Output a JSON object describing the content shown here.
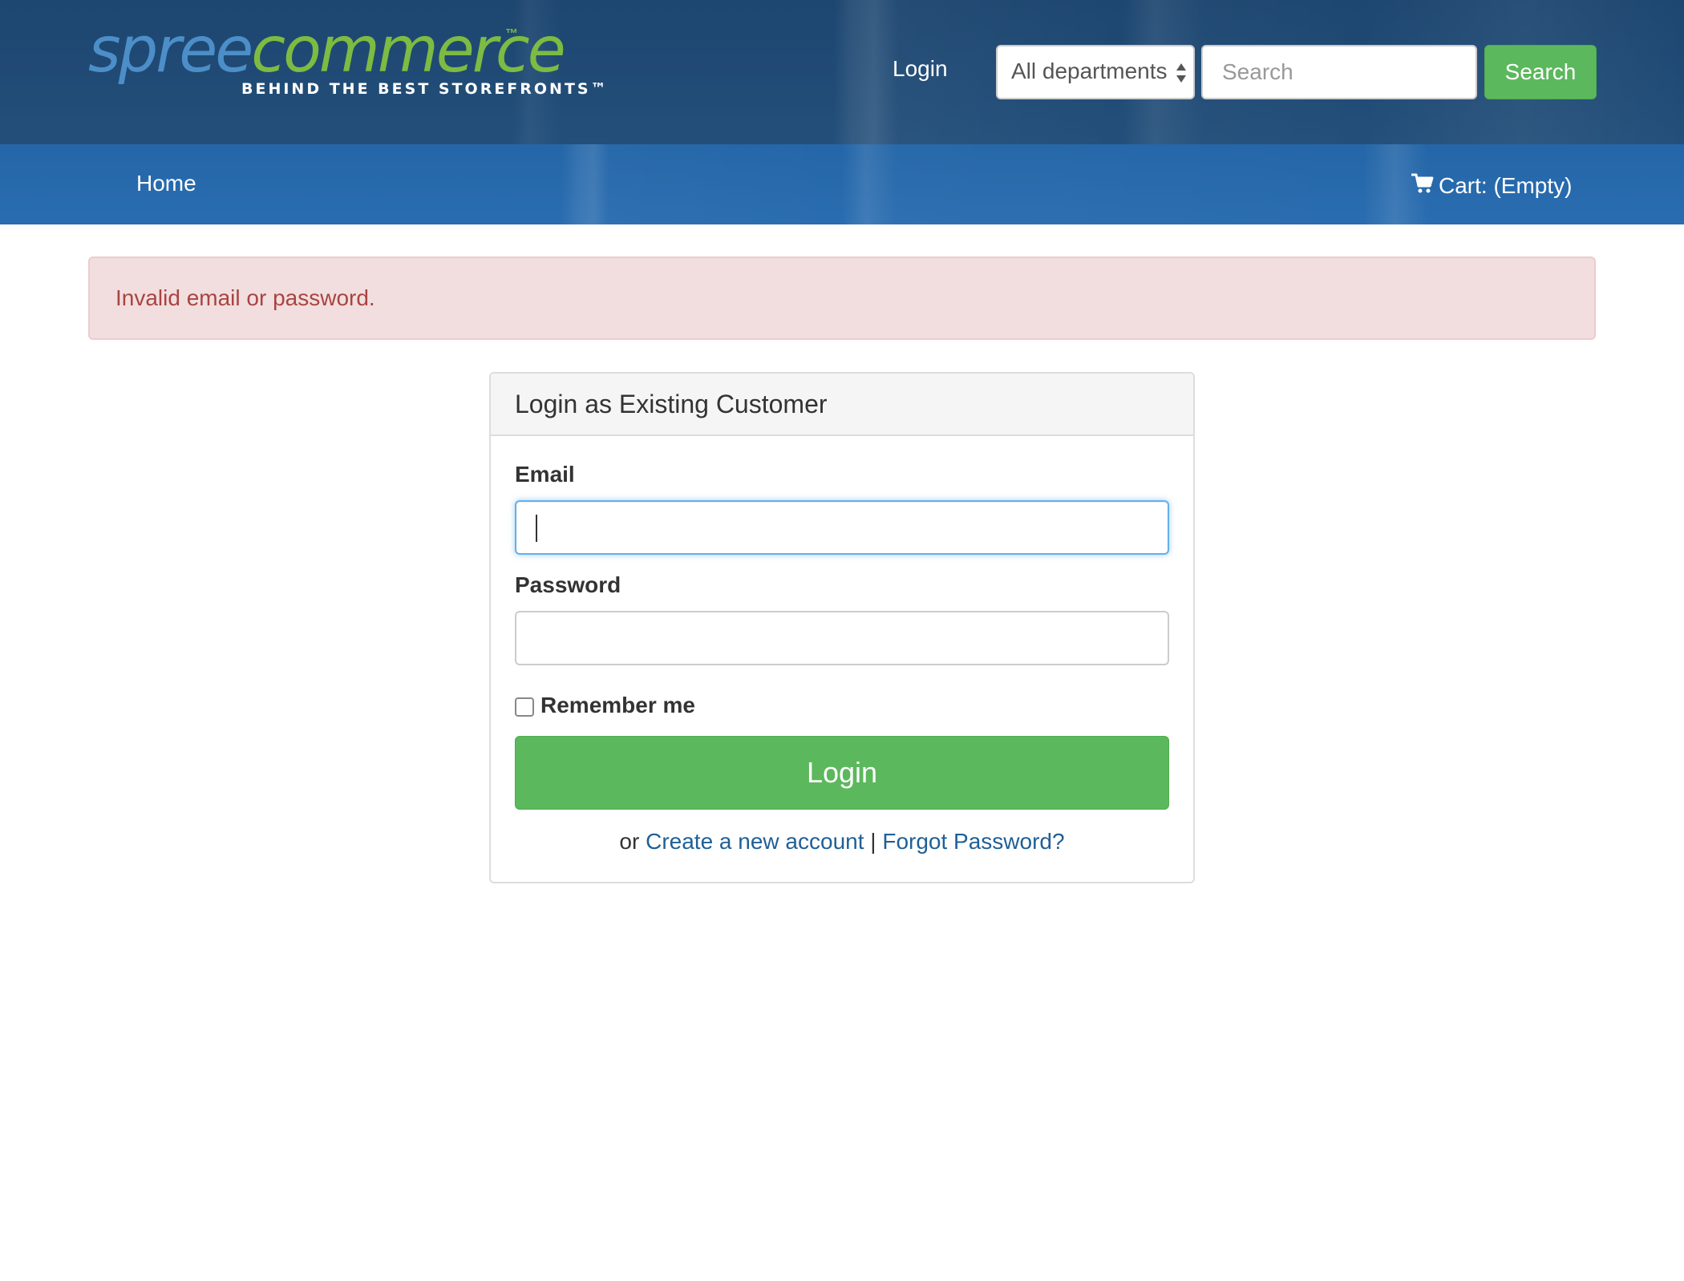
{
  "brand": {
    "logo_part1": "spree",
    "logo_part2": "commerce",
    "logo_tm": "™",
    "tagline": "BEHIND THE BEST STOREFRONTS™"
  },
  "header": {
    "login_link": "Login",
    "department_select": {
      "selected": "All departments"
    },
    "search": {
      "placeholder": "Search",
      "value": "",
      "button_label": "Search"
    }
  },
  "nav": {
    "home": "Home",
    "cart": "Cart: (Empty)"
  },
  "alert": {
    "message": "Invalid email or password."
  },
  "login_panel": {
    "title": "Login as Existing Customer",
    "email_label": "Email",
    "email_value": "",
    "password_label": "Password",
    "password_value": "",
    "remember_label": "Remember me",
    "remember_checked": false,
    "submit_label": "Login",
    "or_text": "or",
    "create_account_link": "Create a new account",
    "separator": "|",
    "forgot_password_link": "Forgot Password?"
  },
  "colors": {
    "header_dark_blue": "#1d4670",
    "nav_blue": "#2466a8",
    "success_green": "#5cb85c",
    "alert_bg": "#f2dede",
    "alert_text": "#a94442",
    "link_blue": "#1f5f96",
    "logo_blue": "#4c8ec8",
    "logo_green": "#7dbb42"
  },
  "icons": {
    "cart": "shopping-cart-icon",
    "select_arrows": "sort-arrows-icon"
  }
}
